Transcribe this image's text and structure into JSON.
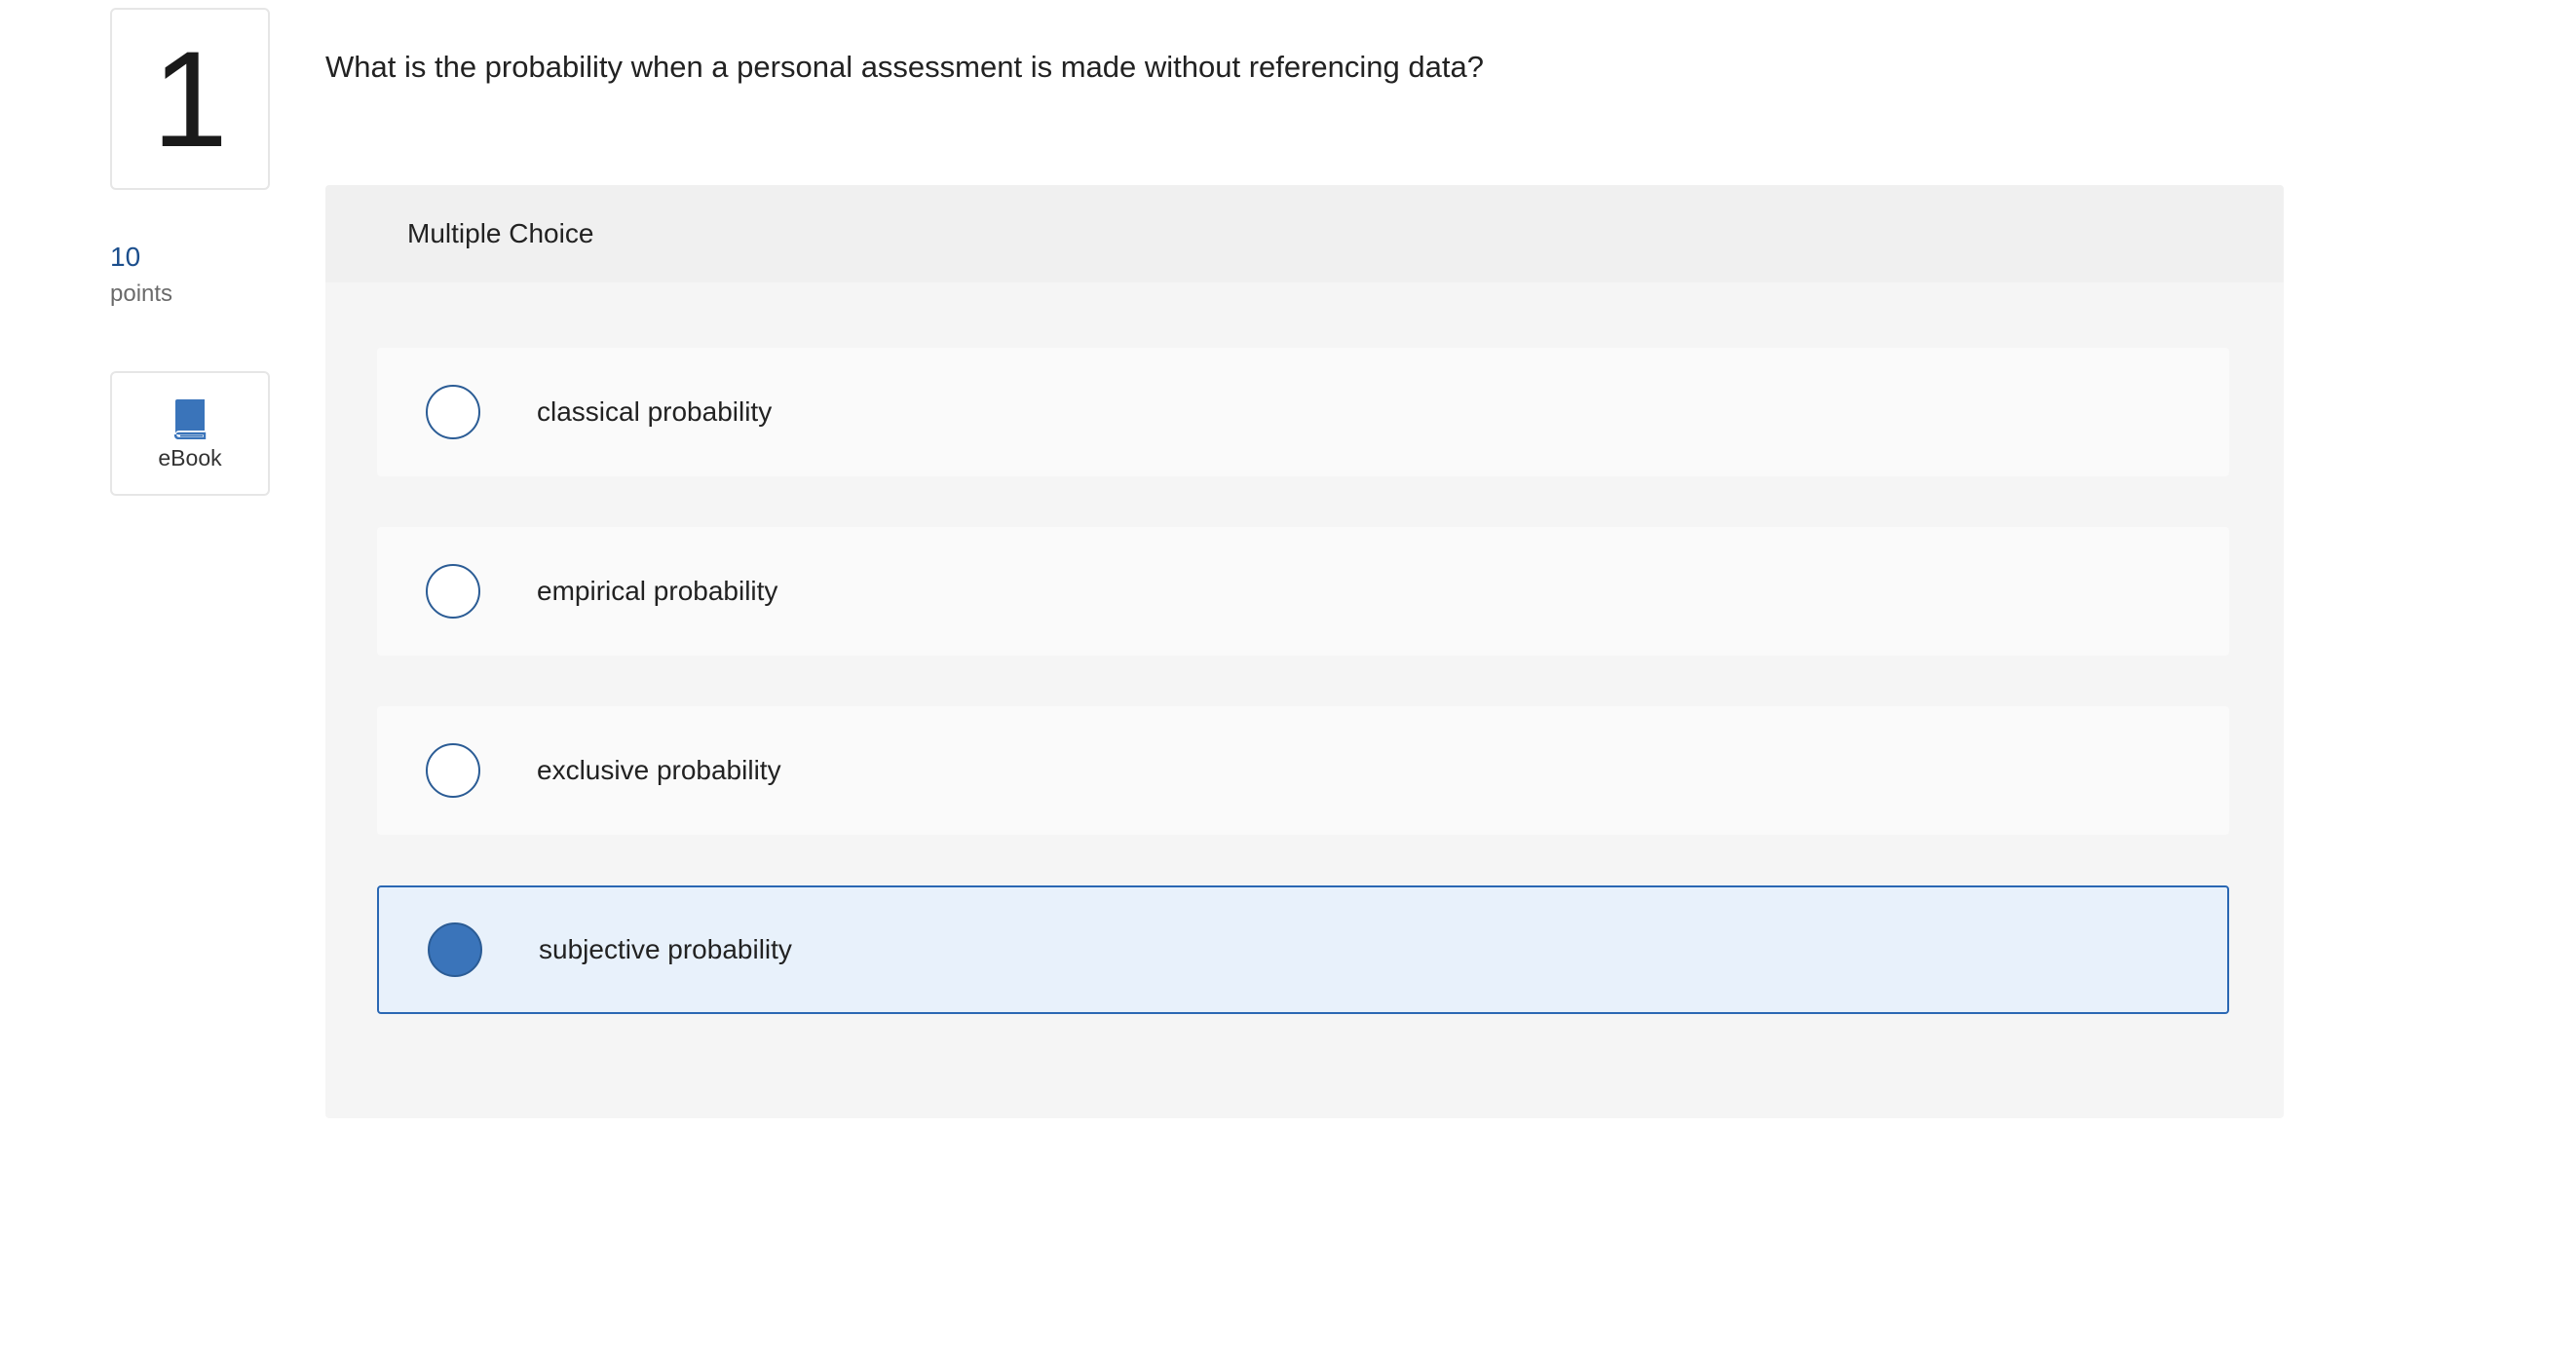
{
  "question": {
    "number": "1",
    "text": "What is the probability when a personal assessment is made without referencing data?",
    "points_value": "10",
    "points_label": "points"
  },
  "ebook": {
    "label": "eBook",
    "icon": "book-icon"
  },
  "panel": {
    "header": "Multiple Choice",
    "options": [
      {
        "label": "classical probability",
        "selected": false
      },
      {
        "label": "empirical probability",
        "selected": false
      },
      {
        "label": "exclusive probability",
        "selected": false
      },
      {
        "label": "subjective probability",
        "selected": true
      }
    ]
  },
  "colors": {
    "accent": "#2a67b3",
    "selected_fill": "#3a74ba",
    "selected_bg": "#e8f1fb",
    "points_color": "#1b4e8c"
  }
}
